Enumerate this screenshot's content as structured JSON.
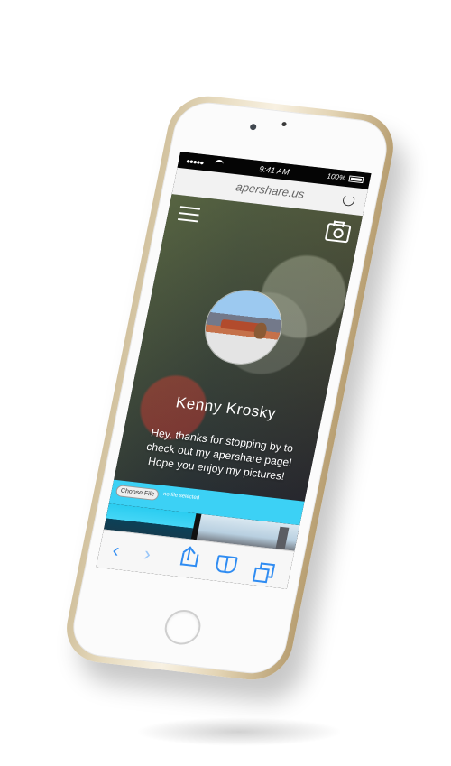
{
  "browser": {
    "status_time": "9:41 AM",
    "battery_label": "100%",
    "battery_level": 1,
    "url": "apershare.us"
  },
  "profile": {
    "name": "Kenny Krosky",
    "welcome_message": "Hey, thanks for stopping by to check out my apershare page! Hope you enjoy my pictures!"
  },
  "upload": {
    "choose_file_label": "Choose File",
    "file_status": "no file selected"
  },
  "toolbar": {
    "back_icon": "‹",
    "forward_icon": "›"
  },
  "icons": {
    "menu": "menu-icon",
    "camera": "camera-icon",
    "reload": "reload-icon",
    "share": "share-icon",
    "bookmarks": "bookmarks-icon",
    "tabs": "tabs-icon"
  },
  "colors": {
    "phone_gold": "#E6D5B1",
    "screen_background": "#2A2A31",
    "upload_bar": "#3CD1F5",
    "ios_blue": "#2F8CF2"
  }
}
